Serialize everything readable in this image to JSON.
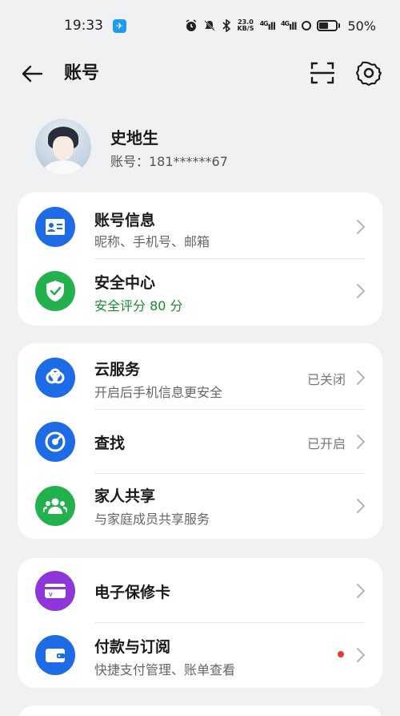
{
  "status_bar": {
    "time": "19:33",
    "net_speed_value": "23.0",
    "net_speed_unit": "KB/S",
    "signal1": "4G",
    "signal2": "4G",
    "battery": "50%"
  },
  "header": {
    "title": "账号"
  },
  "profile": {
    "name": "史地生",
    "account": "账号：181******67"
  },
  "card1": {
    "rows": [
      {
        "title": "账号信息",
        "subtitle": "昵称、手机号、邮箱",
        "icon": "id-card-icon",
        "color": "#1e6be6"
      },
      {
        "title": "安全中心",
        "subtitle": "安全评分 80 分",
        "icon": "shield-check-icon",
        "color": "#22b14c",
        "subtitle_color": "#1a8a2e"
      }
    ]
  },
  "card2": {
    "rows": [
      {
        "title": "云服务",
        "subtitle": "开启后手机信息更安全",
        "status": "已关闭",
        "icon": "cloud-icon",
        "color": "#1e6be6"
      },
      {
        "title": "查找",
        "status": "已开启",
        "icon": "radar-icon",
        "color": "#1e6be6"
      },
      {
        "title": "家人共享",
        "subtitle": "与家庭成员共享服务",
        "icon": "family-icon",
        "color": "#22b14c"
      }
    ]
  },
  "card3": {
    "rows": [
      {
        "title": "电子保修卡",
        "icon": "warranty-card-icon",
        "color": "#8e36d8"
      },
      {
        "title": "付款与订阅",
        "subtitle": "快捷支付管理、账单查看",
        "icon": "wallet-icon",
        "color": "#1e6be6"
      }
    ]
  }
}
